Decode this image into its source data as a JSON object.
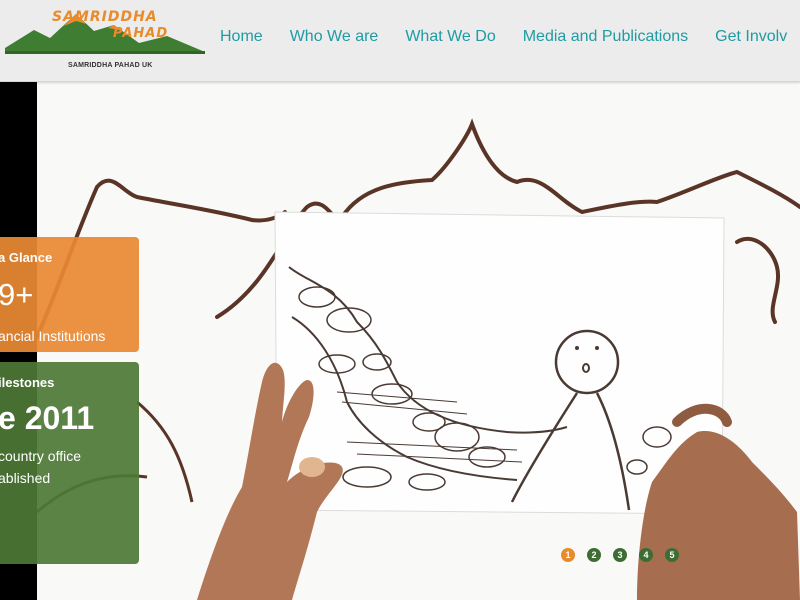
{
  "header": {
    "logo": {
      "title": "SAMRIDDHA",
      "subtitle": "PAHAD",
      "caption": "SAMRIDDHA PAHAD UK",
      "icon": "mountain-logo-icon"
    },
    "nav": [
      {
        "label": "Home"
      },
      {
        "label": "Who We are"
      },
      {
        "label": "What We Do"
      },
      {
        "label": "Media and Publications"
      },
      {
        "label": "Get Involv"
      }
    ]
  },
  "hero": {
    "glance": {
      "heading": "a Glance",
      "value": "9+",
      "description": "ancial Institutions"
    },
    "milestones": {
      "heading": "ilestones",
      "value": "e 2011",
      "description_line1": "country office",
      "description_line2": "ablished"
    },
    "slider": {
      "dots": [
        "1",
        "2",
        "3",
        "4",
        "5"
      ],
      "active_index": 0
    }
  },
  "colors": {
    "nav_text": "#1f9ba3",
    "header_bg": "#ececec",
    "accent_orange": "#e98b2a",
    "accent_green": "#4d7836",
    "dot_green": "#3d6d33"
  }
}
